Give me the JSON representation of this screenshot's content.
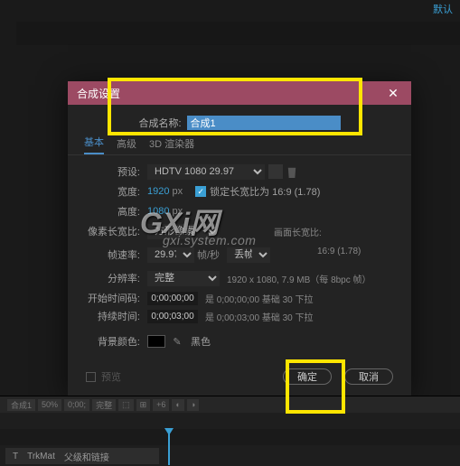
{
  "topbar": {
    "default_label": "默认"
  },
  "dialog": {
    "title": "合成设置",
    "close": "✕",
    "name_label": "合成名称:",
    "name_value": "合成1",
    "tabs": {
      "basic": "基本",
      "advanced": "高级",
      "renderer": "3D 渲染器"
    },
    "preset": {
      "label": "预设:",
      "value": "HDTV 1080 29.97"
    },
    "width": {
      "label": "宽度:",
      "value": "1920",
      "unit": "px"
    },
    "height": {
      "label": "高度:",
      "value": "1080",
      "unit": "px"
    },
    "lock_aspect": {
      "label": "锁定长宽比为 16:9 (1.78)",
      "checked": true
    },
    "pixel_aspect": {
      "label": "像素长宽比:",
      "value": "方形像素",
      "right_label": "画面长宽比:",
      "right_value": "16:9 (1.78)"
    },
    "frame_rate": {
      "label": "帧速率:",
      "value": "29.97",
      "unit_label": "帧/秒",
      "drop": "丢帧"
    },
    "resolution": {
      "label": "分辨率:",
      "value": "完整",
      "info": "1920 x 1080, 7.9 MB（每 8bpc 帧）"
    },
    "start_tc": {
      "label": "开始时间码:",
      "value": "0;00;00;00",
      "desc": "是 0;00;00;00 基础 30 下拉"
    },
    "duration": {
      "label": "持续时间:",
      "value": "0;00;03;00",
      "desc": "是 0;00;03;00 基础 30 下拉"
    },
    "bg_color": {
      "label": "背景颜色:",
      "name": "黑色",
      "hex": "#000000"
    },
    "preview_checkbox": "预览",
    "ok": "确定",
    "cancel": "取消"
  },
  "bottom": {
    "comp_label": "合成1",
    "toolbar_bits": [
      "50%",
      "0;00;",
      "完整",
      "⬚",
      "⊞",
      "+6",
      "◐",
      "◑"
    ],
    "row": {
      "t": "T",
      "trkmat": "TrkMat",
      "parent": "父级和链接"
    }
  },
  "watermark": {
    "big": "GXi网",
    "small": "gxi.system.com"
  }
}
